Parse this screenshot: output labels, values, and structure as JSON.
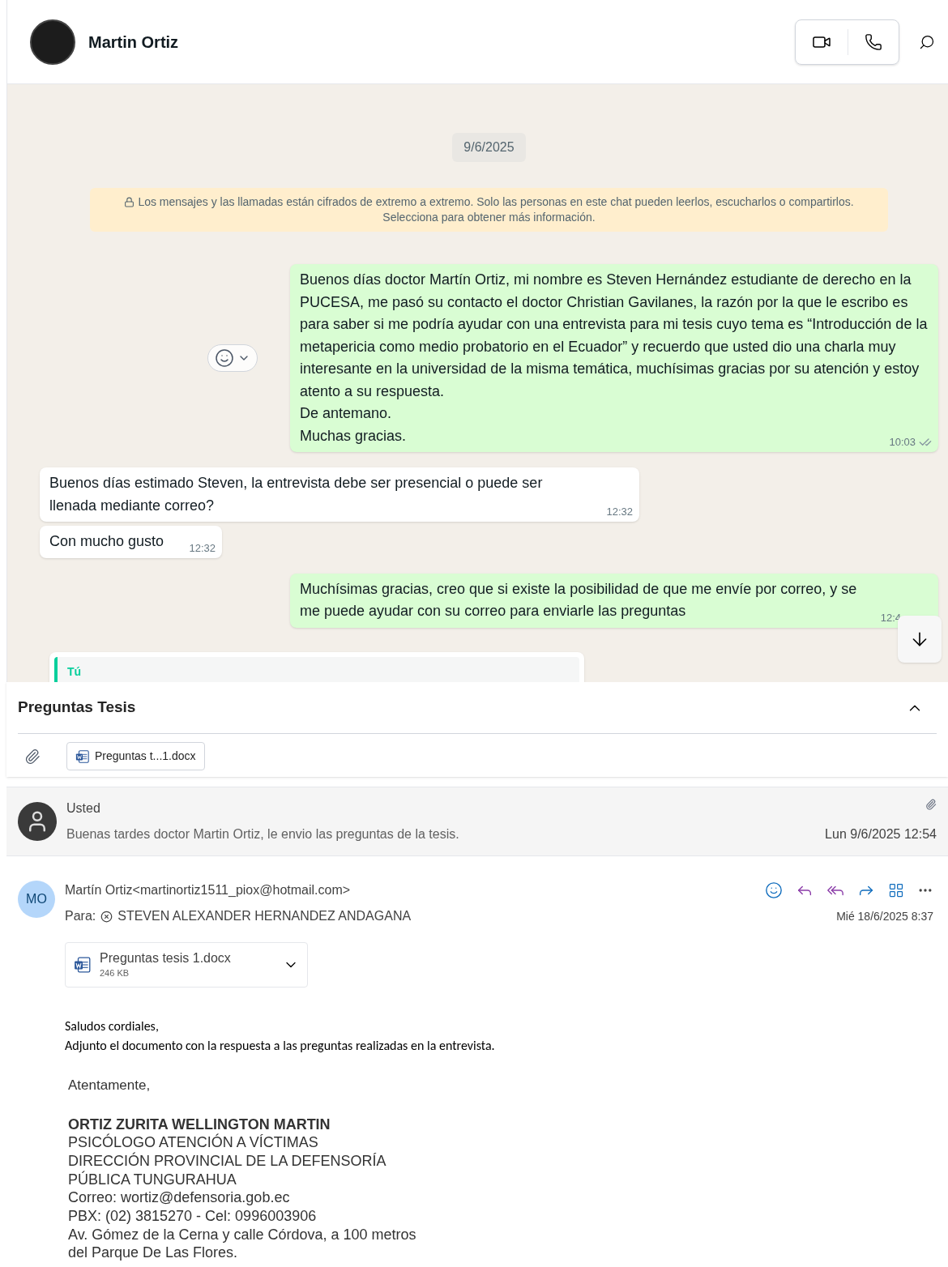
{
  "chat": {
    "contact": "Martin Ortiz",
    "date": "9/6/2025",
    "security_notice": [
      "Los mensajes y las llamadas están cifrados de extremo a extremo. Solo las personas en este chat pueden leerlos, escucharlos o compartirlos.",
      "Selecciona para obtener más información."
    ],
    "messages": [
      {
        "kind": "out",
        "lines": [
          "Buenos días doctor Martín Ortiz, mi nombre es Steven Hernández estudiante de derecho en la PUCESA, me pasó su contacto el doctor Christian Gavilanes, la razón por la que le escribo es para saber si me podría ayudar con una entrevista para mi tesis cuyo tema es “Introducción de la metapericia como medio probatorio en el Ecuador” y recuerdo que usted dio una charla muy interesante en la universidad de la misma temática, muchísimas gracias por su atención y estoy atento a su respuesta.",
          "De antemano.",
          "Muchas gracias."
        ],
        "time": "10:03",
        "read": true
      },
      {
        "kind": "in",
        "lines": [
          "Buenos días estimado Steven, la entrevista debe ser presencial o puede ser llenada mediante correo?"
        ],
        "time": "12:32"
      },
      {
        "kind": "in",
        "lines": [
          "Con mucho gusto"
        ],
        "time": "12:32"
      },
      {
        "kind": "out",
        "lines": [
          "Muchísimas gracias, creo que si existe la posibilidad de que me envíe por correo, y se me puede ayudar con su correo para enviarle las preguntas"
        ],
        "time": "12:4"
      },
      {
        "kind": "reply",
        "quote_author": "Tú"
      }
    ]
  },
  "mail": {
    "subject": "Preguntas Tesis",
    "attachment_chip": "Preguntas t...1.docx",
    "collapsed_message": {
      "sender": "Usted",
      "preview": "Buenas tardes doctor Martin Ortiz, le envio las preguntas de la tesis.",
      "date": "Lun 9/6/2025 12:54"
    },
    "message": {
      "initials": "MO",
      "from": "Martín Ortiz<martinortiz1511_piox@hotmail.com>",
      "to_label": "Para:",
      "to": "STEVEN ALEXANDER HERNANDEZ ANDAGANA",
      "date": "Mié 18/6/2025 8:37",
      "attachment": {
        "name": "Preguntas tesis 1.docx",
        "size": "246 KB"
      },
      "body": [
        "Saludos cordiales,",
        "Adjunto el documento con la respuesta a las preguntas realizadas en la entrevista."
      ],
      "closing": "Atentamente,",
      "signature": [
        {
          "kind": "name",
          "text": "ORTIZ ZURITA WELLINGTON MARTIN"
        },
        {
          "kind": "line",
          "text": "PSICÓLOGO ATENCIÓN A VÍCTIMAS"
        },
        {
          "kind": "line",
          "text": "DIRECCIÓN PROVINCIAL DE LA DEFENSORÍA"
        },
        {
          "kind": "line",
          "text": "PÚBLICA TUNGURAHUA"
        },
        {
          "kind": "line",
          "text": "Correo: wortiz@defensoria.gob.ec"
        },
        {
          "kind": "line",
          "text": "PBX: (02) 3815270 - Cel: 0996003906"
        },
        {
          "kind": "line",
          "text": "Av. Gómez de la Cerna y calle Córdova, a 100 metros"
        },
        {
          "kind": "line",
          "text": "del Parque De Las Flores."
        }
      ]
    }
  }
}
